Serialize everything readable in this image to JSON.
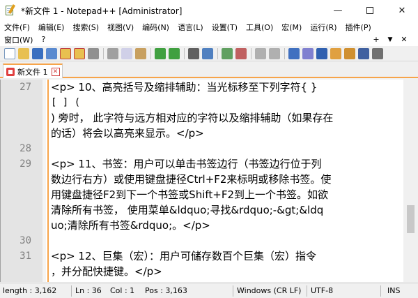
{
  "window": {
    "title": "*新文件 1 - Notepad++ [Administrator]",
    "minimize": "—",
    "close": "✕"
  },
  "menu": {
    "row1": [
      "文件(F)",
      "编辑(E)",
      "搜索(S)",
      "视图(V)",
      "编码(N)",
      "语言(L)",
      "设置(T)",
      "工具(O)",
      "宏(M)",
      "运行(R)",
      "插件(P)"
    ],
    "row2": [
      "窗口(W)",
      "?"
    ],
    "plus": "+",
    "dropdown": "▼",
    "close_doc": "✕"
  },
  "tab": {
    "label": "新文件 1",
    "close": "✕"
  },
  "editor": {
    "line_numbers": [
      "27",
      "",
      "",
      "",
      "28",
      "29",
      "",
      "",
      "",
      "",
      "30",
      "31",
      ""
    ],
    "lines": [
      "<p>    10、高亮括号及缩排辅助：当光标移至下列字符{ }",
      "[ ]  (",
      ") 旁时， 此字符与远方相对应的字符以及缩排辅助（如果存在",
      "的话）将会以高亮来显示。</p>",
      "",
      "<p>    11、书签：用户可以单击书签边行（书签边行位于列",
      "数边行右方）或使用键盘捷径Ctrl+F2来标明或移除书签。使",
      "用键盘捷径F2到下一个书签或Shift+F2到上一个书签。如欲",
      "清除所有书签， 使用菜单&ldquo;寻找&rdquo;-&gt;&ldq",
      "uo;清除所有书签&rdquo;。</p>",
      "",
      "<p>    12、巨集（宏）：用户可储存数百个巨集（宏）指令",
      "，并分配快捷键。</p>"
    ]
  },
  "status": {
    "length": "length : 3,162",
    "ln": "Ln : 36",
    "col": "Col : 1",
    "pos": "Pos : 3,163",
    "eol": "Windows (CR LF)",
    "encoding": "UTF-8",
    "mode": "INS"
  }
}
